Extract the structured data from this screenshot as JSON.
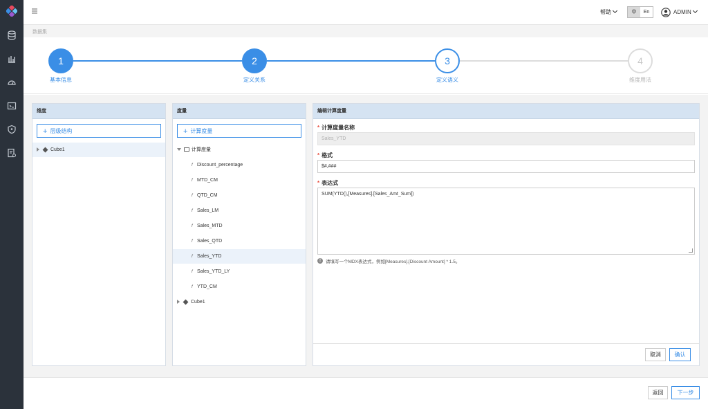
{
  "topbar": {
    "help_label": "帮助",
    "lang_zh": "中",
    "lang_en": "En",
    "user_name": "ADMIN"
  },
  "breadcrumb": "数据集",
  "steps": [
    {
      "number": "1",
      "label": "基本信息",
      "status": "done"
    },
    {
      "number": "2",
      "label": "定义关系",
      "status": "done"
    },
    {
      "number": "3",
      "label": "定义语义",
      "status": "current"
    },
    {
      "number": "4",
      "label": "维度用法",
      "status": "todo"
    }
  ],
  "dimension_panel": {
    "title": "维度",
    "add_label": "层级结构",
    "items": [
      {
        "label": "Cube1"
      }
    ]
  },
  "measure_panel": {
    "title": "度量",
    "add_label": "计算度量",
    "group_label": "计算度量",
    "items": [
      {
        "label": "Discount_percentage"
      },
      {
        "label": "MTD_CM"
      },
      {
        "label": "QTD_CM"
      },
      {
        "label": "Sales_LM"
      },
      {
        "label": "Sales_MTD"
      },
      {
        "label": "Sales_QTD"
      },
      {
        "label": "Sales_YTD"
      },
      {
        "label": "Sales_YTD_LY"
      },
      {
        "label": "YTD_CM"
      }
    ],
    "item_icon": "f",
    "cube_label": "Cube1"
  },
  "edit_panel": {
    "title": "编辑计算度量",
    "name_label": "计算度量名称",
    "name_value": "Sales_YTD",
    "format_label": "格式",
    "format_value": "$#,###",
    "expression_label": "表达式",
    "expression_value": "SUM(YTD(),[Measures].[Sales_Amt_Sum])",
    "hint": "请填写一个MDX表达式，例如[Measures].[Discount Amount] * 1.5。",
    "cancel_label": "取消",
    "confirm_label": "确认"
  },
  "footer": {
    "back_label": "返回",
    "next_label": "下一步"
  },
  "colors": {
    "accent": "#3a8ee6",
    "sidebar": "#2b323b",
    "panel_header": "#d5e3f2",
    "required": "#e84c3d"
  }
}
